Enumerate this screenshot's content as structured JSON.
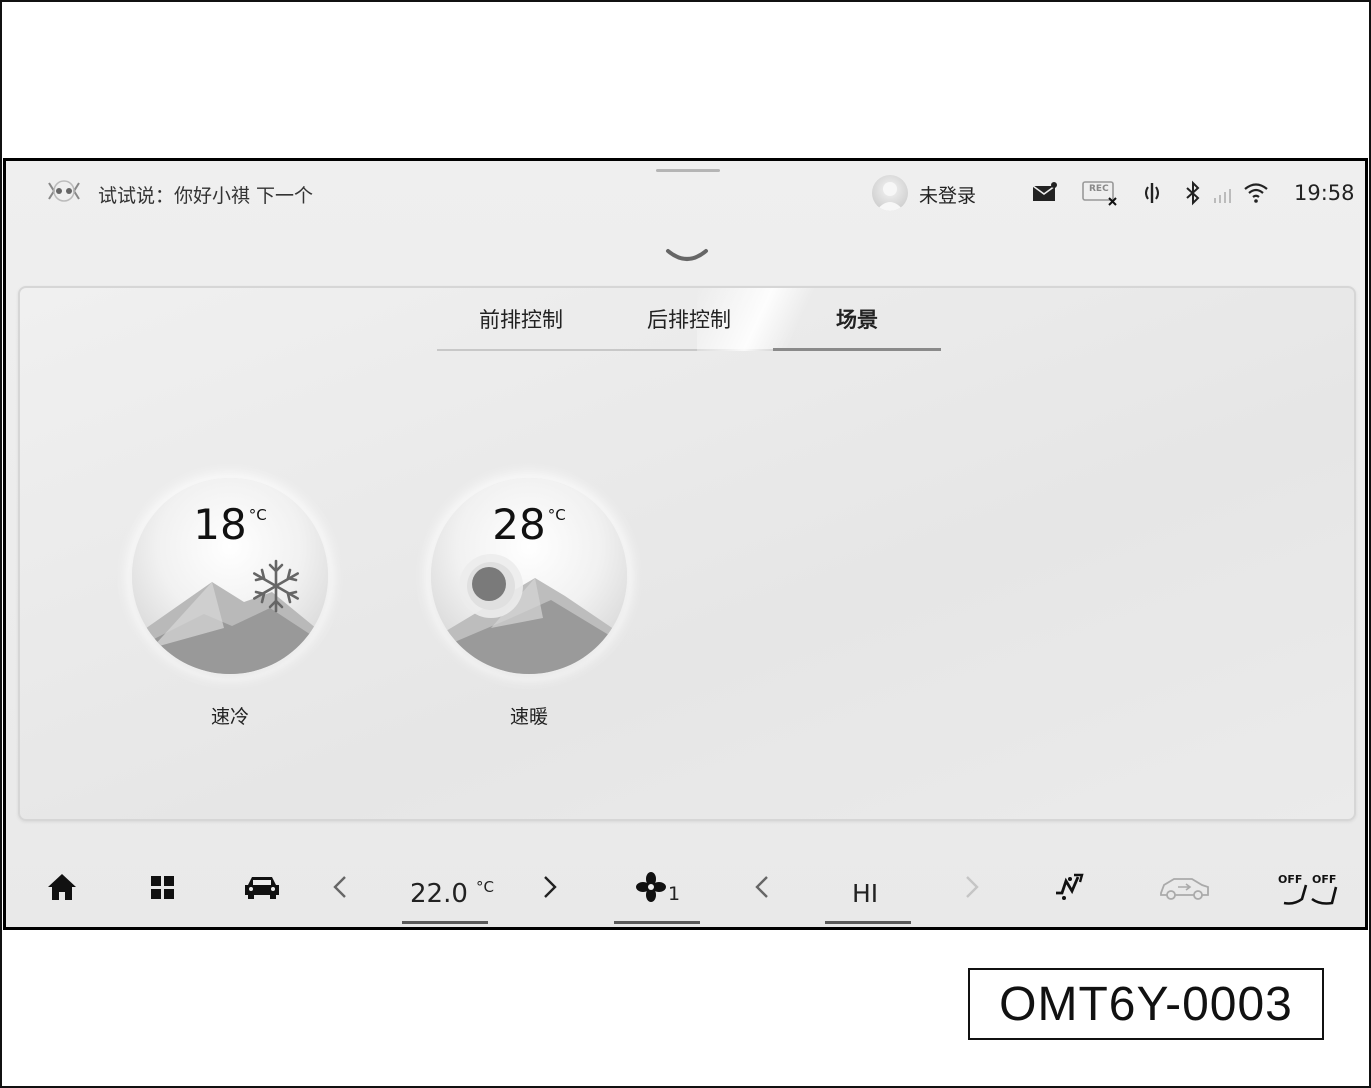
{
  "status_bar": {
    "voice_hint": "试试说：你好小祺 下一个",
    "login": "未登录",
    "time": "19:58",
    "rec_label": "REC"
  },
  "tabs": [
    {
      "label": "前排控制",
      "active": false
    },
    {
      "label": "后排控制",
      "active": false
    },
    {
      "label": "场景",
      "active": true
    }
  ],
  "scenes": [
    {
      "temp": "18",
      "unit": "°C",
      "label": "速冷",
      "icon": "snowflake-icon"
    },
    {
      "temp": "28",
      "unit": "°C",
      "label": "速暖",
      "icon": "sun-icon"
    }
  ],
  "bottom_bar": {
    "temperature": "22.0",
    "temp_unit": "°C",
    "fan_level": "1",
    "seat_level": "HI",
    "off_label": "OFF"
  },
  "figure_code": "OMT6Y-0003"
}
